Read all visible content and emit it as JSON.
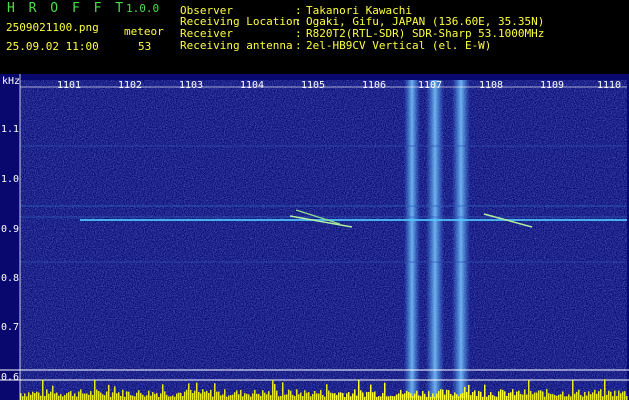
{
  "header": {
    "app_title": "H R O F F T",
    "version": "1.0.0",
    "filename": "2509021100.png",
    "meteor_label": "meteor",
    "datetime": "25.09.02 11:00",
    "meteor_count": "53",
    "info": [
      {
        "label": "Observer",
        "value": "Takanori Kawachi"
      },
      {
        "label": "Receiving Location",
        "value": "Ogaki, Gifu, JAPAN (136.60E, 35.35N)"
      },
      {
        "label": "Receiver",
        "value": "R820T2(RTL-SDR) SDR-Sharp 53.1000MHz"
      },
      {
        "label": "Receiving antenna",
        "value": "2el-HB9CV Vertical (el. E-W)"
      }
    ]
  },
  "spectrogram": {
    "unit_label": "kHz",
    "x_labels": [
      "1101",
      "1102",
      "1103",
      "1104",
      "1105",
      "1106",
      "1107",
      "1108",
      "1109",
      "1110"
    ],
    "y_labels": [
      "1.1",
      "1.0",
      "0.9",
      "0.8",
      "0.7",
      "0.6"
    ],
    "colors": {
      "background": "#0a0a7a",
      "signal": "#60c0ff",
      "trace": "#a0f0a0",
      "baseline": "#ffff00"
    }
  }
}
